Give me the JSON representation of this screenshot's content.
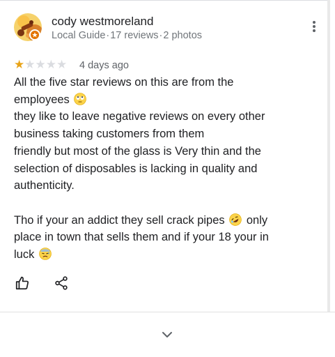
{
  "review": {
    "author": "cody westmoreland",
    "author_meta": {
      "badge": "Local Guide",
      "reviews": "17 reviews",
      "photos": "2 photos",
      "separator": "·"
    },
    "rating": 1,
    "rating_max": 5,
    "date": "4 days ago",
    "lines": [
      "All the five star reviews on this are from the",
      "employees",
      "they like to leave negative reviews on every other",
      "business taking customers from them",
      "friendly but most of the glass is Very thin and the",
      "selection of disposables is lacking in quality and",
      "authenticity.",
      "",
      "Tho if your an addict they sell crack pipes",
      "only",
      "place in town that sells them and if your 18 your in",
      "luck"
    ]
  },
  "icons": {
    "more": "more-vert-icon",
    "like": "thumb-up-icon",
    "share": "share-icon",
    "expand": "chevron-down-icon",
    "emoji_eyeroll": "face-with-rolling-eyes-emoji",
    "emoji_rofl": "rolling-on-floor-laughing-emoji",
    "emoji_sweat": "downcast-face-with-sweat-emoji"
  },
  "colors": {
    "star_on": "#e8a317",
    "star_off": "#dadce0",
    "text": "#202124",
    "secondary": "#70757a",
    "guide_badge": "#e37400"
  }
}
